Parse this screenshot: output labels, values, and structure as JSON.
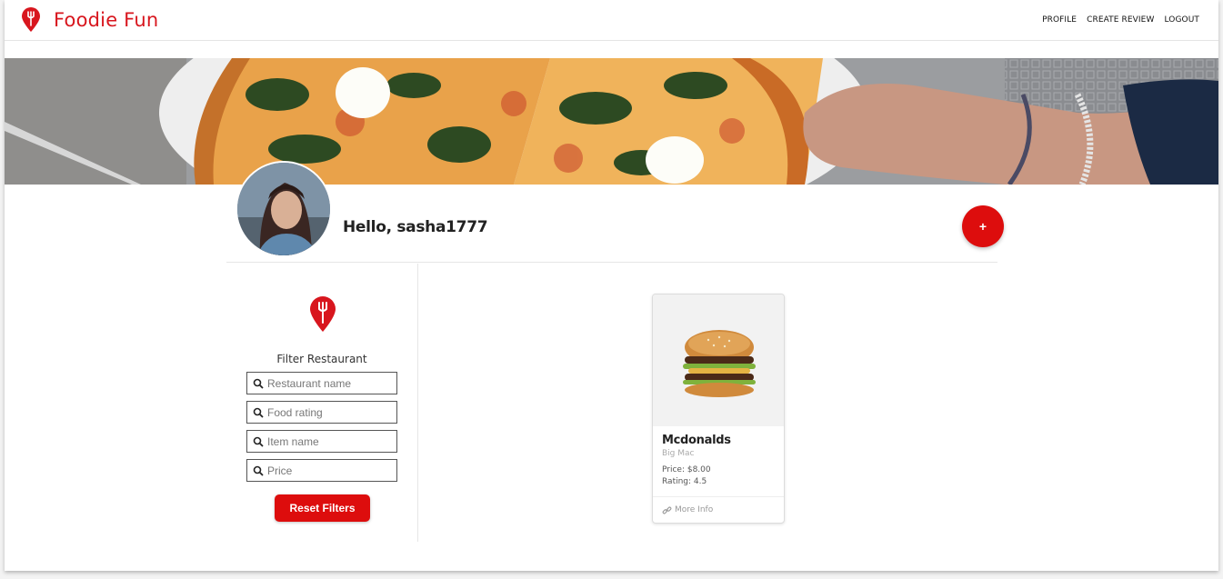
{
  "app": {
    "name": "Foodie Fun",
    "brand_color": "#d8161e"
  },
  "nav": {
    "links": [
      "PROFILE",
      "CREATE REVIEW",
      "LOGOUT"
    ]
  },
  "banner": {
    "image": "pizza-banner"
  },
  "profile": {
    "greeting": "Hello, sasha1777",
    "add_label": "+"
  },
  "filters": {
    "title": "Filter Restaurant",
    "fields": [
      {
        "placeholder": "Restaurant name",
        "value": ""
      },
      {
        "placeholder": "Food rating",
        "value": ""
      },
      {
        "placeholder": "Item name",
        "value": ""
      },
      {
        "placeholder": "Price",
        "value": ""
      }
    ],
    "reset_label": "Reset Filters"
  },
  "reviews": [
    {
      "restaurant": "Mcdonalds",
      "item": "Big Mac",
      "price": "Price: $8.00",
      "rating": "Rating: 4.5",
      "link": "More Info",
      "image": "burger-photo"
    }
  ]
}
